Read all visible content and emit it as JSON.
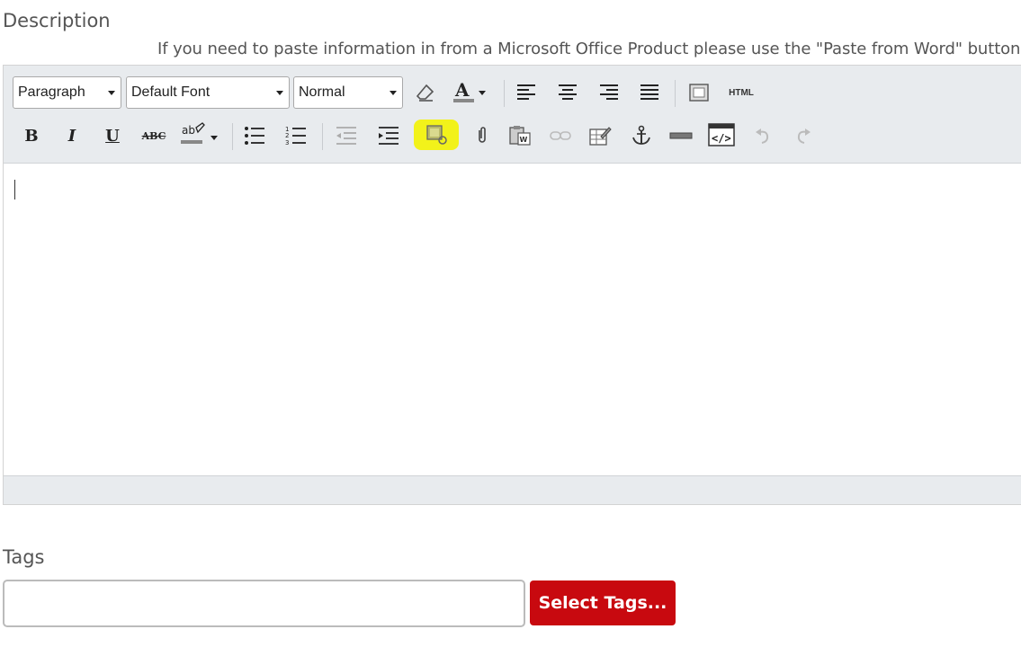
{
  "description": {
    "label": "Description",
    "hint": "If you need to paste information in from a Microsoft Office Product please use the \"Paste from Word\" button."
  },
  "toolbar": {
    "format_select": "Paragraph",
    "font_select": "Default Font",
    "size_select": "Normal",
    "html_label": "HTML",
    "bold": "B",
    "italic": "I",
    "underline": "U",
    "strike": "ABC"
  },
  "highlight_color": "#f2f21a",
  "tags": {
    "label": "Tags",
    "input_value": "",
    "button_label": "Select Tags..."
  },
  "colors": {
    "button_red": "#c8090f",
    "toolbar_bg": "#e8ebee"
  }
}
